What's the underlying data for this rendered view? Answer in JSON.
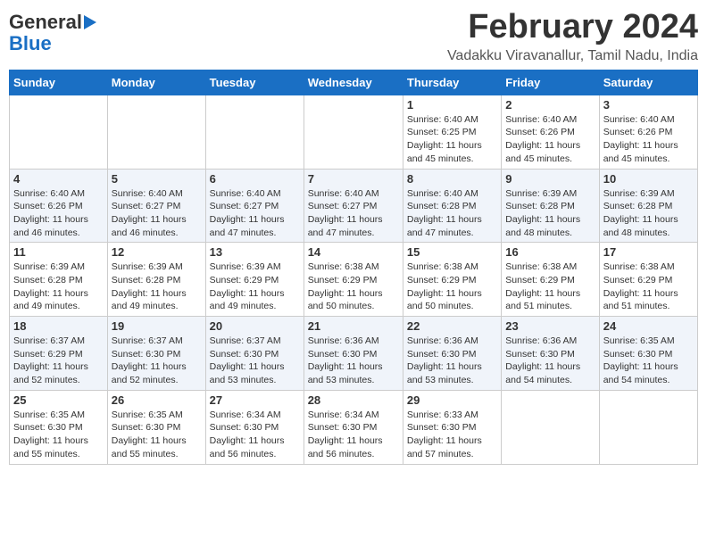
{
  "logo": {
    "general": "General",
    "blue": "Blue"
  },
  "title": {
    "month": "February 2024",
    "location": "Vadakku Viravanallur, Tamil Nadu, India"
  },
  "headers": [
    "Sunday",
    "Monday",
    "Tuesday",
    "Wednesday",
    "Thursday",
    "Friday",
    "Saturday"
  ],
  "weeks": [
    [
      {
        "day": "",
        "info": ""
      },
      {
        "day": "",
        "info": ""
      },
      {
        "day": "",
        "info": ""
      },
      {
        "day": "",
        "info": ""
      },
      {
        "day": "1",
        "info": "Sunrise: 6:40 AM\nSunset: 6:25 PM\nDaylight: 11 hours\nand 45 minutes."
      },
      {
        "day": "2",
        "info": "Sunrise: 6:40 AM\nSunset: 6:26 PM\nDaylight: 11 hours\nand 45 minutes."
      },
      {
        "day": "3",
        "info": "Sunrise: 6:40 AM\nSunset: 6:26 PM\nDaylight: 11 hours\nand 45 minutes."
      }
    ],
    [
      {
        "day": "4",
        "info": "Sunrise: 6:40 AM\nSunset: 6:26 PM\nDaylight: 11 hours\nand 46 minutes."
      },
      {
        "day": "5",
        "info": "Sunrise: 6:40 AM\nSunset: 6:27 PM\nDaylight: 11 hours\nand 46 minutes."
      },
      {
        "day": "6",
        "info": "Sunrise: 6:40 AM\nSunset: 6:27 PM\nDaylight: 11 hours\nand 47 minutes."
      },
      {
        "day": "7",
        "info": "Sunrise: 6:40 AM\nSunset: 6:27 PM\nDaylight: 11 hours\nand 47 minutes."
      },
      {
        "day": "8",
        "info": "Sunrise: 6:40 AM\nSunset: 6:28 PM\nDaylight: 11 hours\nand 47 minutes."
      },
      {
        "day": "9",
        "info": "Sunrise: 6:39 AM\nSunset: 6:28 PM\nDaylight: 11 hours\nand 48 minutes."
      },
      {
        "day": "10",
        "info": "Sunrise: 6:39 AM\nSunset: 6:28 PM\nDaylight: 11 hours\nand 48 minutes."
      }
    ],
    [
      {
        "day": "11",
        "info": "Sunrise: 6:39 AM\nSunset: 6:28 PM\nDaylight: 11 hours\nand 49 minutes."
      },
      {
        "day": "12",
        "info": "Sunrise: 6:39 AM\nSunset: 6:28 PM\nDaylight: 11 hours\nand 49 minutes."
      },
      {
        "day": "13",
        "info": "Sunrise: 6:39 AM\nSunset: 6:29 PM\nDaylight: 11 hours\nand 49 minutes."
      },
      {
        "day": "14",
        "info": "Sunrise: 6:38 AM\nSunset: 6:29 PM\nDaylight: 11 hours\nand 50 minutes."
      },
      {
        "day": "15",
        "info": "Sunrise: 6:38 AM\nSunset: 6:29 PM\nDaylight: 11 hours\nand 50 minutes."
      },
      {
        "day": "16",
        "info": "Sunrise: 6:38 AM\nSunset: 6:29 PM\nDaylight: 11 hours\nand 51 minutes."
      },
      {
        "day": "17",
        "info": "Sunrise: 6:38 AM\nSunset: 6:29 PM\nDaylight: 11 hours\nand 51 minutes."
      }
    ],
    [
      {
        "day": "18",
        "info": "Sunrise: 6:37 AM\nSunset: 6:29 PM\nDaylight: 11 hours\nand 52 minutes."
      },
      {
        "day": "19",
        "info": "Sunrise: 6:37 AM\nSunset: 6:30 PM\nDaylight: 11 hours\nand 52 minutes."
      },
      {
        "day": "20",
        "info": "Sunrise: 6:37 AM\nSunset: 6:30 PM\nDaylight: 11 hours\nand 53 minutes."
      },
      {
        "day": "21",
        "info": "Sunrise: 6:36 AM\nSunset: 6:30 PM\nDaylight: 11 hours\nand 53 minutes."
      },
      {
        "day": "22",
        "info": "Sunrise: 6:36 AM\nSunset: 6:30 PM\nDaylight: 11 hours\nand 53 minutes."
      },
      {
        "day": "23",
        "info": "Sunrise: 6:36 AM\nSunset: 6:30 PM\nDaylight: 11 hours\nand 54 minutes."
      },
      {
        "day": "24",
        "info": "Sunrise: 6:35 AM\nSunset: 6:30 PM\nDaylight: 11 hours\nand 54 minutes."
      }
    ],
    [
      {
        "day": "25",
        "info": "Sunrise: 6:35 AM\nSunset: 6:30 PM\nDaylight: 11 hours\nand 55 minutes."
      },
      {
        "day": "26",
        "info": "Sunrise: 6:35 AM\nSunset: 6:30 PM\nDaylight: 11 hours\nand 55 minutes."
      },
      {
        "day": "27",
        "info": "Sunrise: 6:34 AM\nSunset: 6:30 PM\nDaylight: 11 hours\nand 56 minutes."
      },
      {
        "day": "28",
        "info": "Sunrise: 6:34 AM\nSunset: 6:30 PM\nDaylight: 11 hours\nand 56 minutes."
      },
      {
        "day": "29",
        "info": "Sunrise: 6:33 AM\nSunset: 6:30 PM\nDaylight: 11 hours\nand 57 minutes."
      },
      {
        "day": "",
        "info": ""
      },
      {
        "day": "",
        "info": ""
      }
    ]
  ]
}
